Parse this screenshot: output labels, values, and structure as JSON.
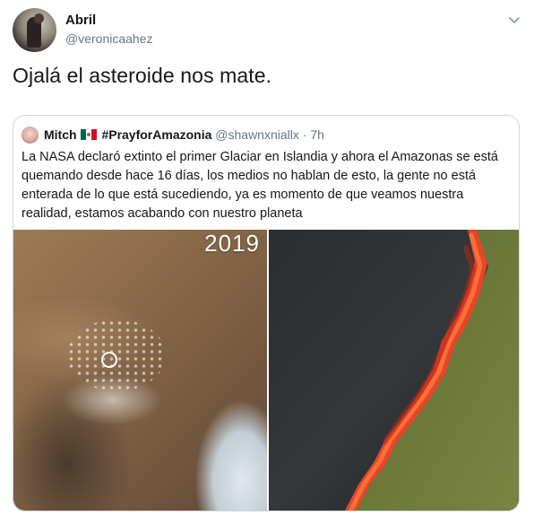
{
  "author": {
    "name": "Abril",
    "handle": "@veronicaahez"
  },
  "tweet_text": "Ojalá el asteroide nos mate.",
  "quoted": {
    "name": "Mitch",
    "hashtag": "#PrayforAmazonia",
    "handle": "@shawnxniallx",
    "separator": "·",
    "time": "7h",
    "text": "La NASA declaró extinto el primer Glaciar en Islandia y ahora el Amazonas se está quemando desde hace 16 días, los medios no hablan de esto, la gente no está enterada de lo que está sucediendo, ya es momento de que veamos nuestra realidad, estamos acabando con nuestro planeta",
    "image_year": "2019"
  },
  "icons": {
    "menu": "chevron-down-icon",
    "flag": "mexico-flag-icon"
  },
  "colors": {
    "text": "#14171a",
    "secondary": "#657786",
    "border": "#ccd6dd",
    "fire": "#e8442a",
    "grass": "#6f7a3c"
  }
}
